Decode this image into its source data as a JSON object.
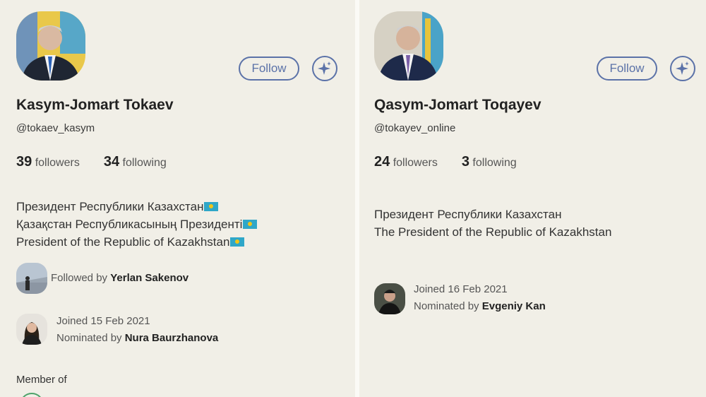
{
  "left": {
    "name": "Kasym-Jomart Tokaev",
    "handle": "@tokaev_kasym",
    "followers_count": "39",
    "followers_label": "followers",
    "following_count": "34",
    "following_label": "following",
    "follow_button": "Follow",
    "bio_lines": [
      "Президент Республики Казахстан",
      "Қазақстан Республикасының Президенті",
      "President of the Republic of Kazakhstan"
    ],
    "followed_by_prefix": "Followed by ",
    "followed_by_name": "Yerlan Sakenov",
    "joined": "Joined 15 Feb 2021",
    "nominated_prefix": "Nominated by ",
    "nominated_name": "Nura Baurzhanova",
    "member_of": "Member of"
  },
  "right": {
    "name": "Qasym-Jomart Toqayev",
    "handle": "@tokayev_online",
    "followers_count": "24",
    "followers_label": "followers",
    "following_count": "3",
    "following_label": "following",
    "follow_button": "Follow",
    "bio_lines": [
      "Президент Республики Казахстан",
      "The President of the Republic of Kazakhstan"
    ],
    "joined": "Joined 16 Feb 2021",
    "nominated_prefix": "Nominated by ",
    "nominated_name": "Evgeniy Kan"
  },
  "icons": {
    "sparkle": "sparkle-icon",
    "flag": "kazakhstan-flag-icon"
  },
  "colors": {
    "background": "#f1efe7",
    "accent": "#5b72a8",
    "green": "#4fa36b"
  }
}
